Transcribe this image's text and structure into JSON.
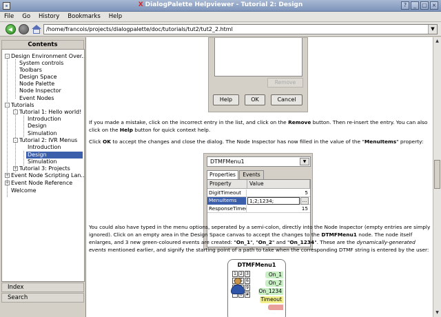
{
  "window": {
    "title": "DialogPalette Helpviewer - Tutorial 2: Design",
    "controls": [
      "?",
      "_",
      "□",
      "×"
    ]
  },
  "menubar": {
    "items": [
      "File",
      "Go",
      "History",
      "Bookmarks",
      "Help"
    ]
  },
  "toolbar": {
    "url": "/home/francois/projects/dialogpalette/doc/tutorials/tut2/tut2_2.html"
  },
  "sidebar": {
    "header": "Contents",
    "tree": [
      {
        "label": "Design Environment Over...",
        "level": 0,
        "expander": "-"
      },
      {
        "label": "System controls",
        "level": 1
      },
      {
        "label": "Toolbars",
        "level": 1
      },
      {
        "label": "Design Space",
        "level": 1
      },
      {
        "label": "Node Palette",
        "level": 1
      },
      {
        "label": "Node Inspector",
        "level": 1
      },
      {
        "label": "Event Nodes",
        "level": 1
      },
      {
        "label": "Tutorials",
        "level": 0,
        "expander": "-"
      },
      {
        "label": "Tutorial 1: Hello world!",
        "level": 1,
        "expander": "-"
      },
      {
        "label": "Introduction",
        "level": 2
      },
      {
        "label": "Design",
        "level": 2
      },
      {
        "label": "Simulation",
        "level": 2
      },
      {
        "label": "Tutorial 2: IVR Menus",
        "level": 1,
        "expander": "-"
      },
      {
        "label": "Introduction",
        "level": 2
      },
      {
        "label": "Design",
        "level": 2,
        "selected": true
      },
      {
        "label": "Simulation",
        "level": 2
      },
      {
        "label": "Tutorial 3: Projects",
        "level": 1,
        "expander": "+"
      },
      {
        "label": "Event Node Scripting Lan...",
        "level": 0,
        "expander": "+"
      },
      {
        "label": "Event Node Reference",
        "level": 0,
        "expander": "+"
      },
      {
        "label": "Welcome",
        "level": 0
      }
    ],
    "tabs": [
      "Index",
      "Search"
    ]
  },
  "content": {
    "dialog": {
      "remove": "Remove",
      "help": "Help",
      "ok": "OK",
      "cancel": "Cancel"
    },
    "p1": {
      "a": "If you made a mistake, click on the incorrect entry in the list, and click on the ",
      "b": "Remove",
      "c": " button. Then re-insert the entry. You can also click on the ",
      "d": "Help",
      "e": " button for quick context help."
    },
    "p2": {
      "a": "Click ",
      "b": "OK",
      "c": " to accept the changes and close the dialog. The Node Inspector has now filled in the value of the \"",
      "d": "MenuItems",
      "e": "\" property:"
    },
    "inspector": {
      "combo": "DTMFMenu1",
      "tabs": [
        "Properties",
        "Events"
      ],
      "col_property": "Property",
      "col_value": "Value",
      "rows": [
        {
          "prop": "DigitTimeout",
          "value": "5"
        },
        {
          "prop": "MenuItems",
          "value": "1;2;1234;"
        },
        {
          "prop": "ResponseTimeout",
          "value": "15"
        }
      ],
      "edit_button": "..."
    },
    "p3": {
      "a": "You could also have typed in the menu options, seperated by a semi-colon, directly into the Node Inspector (empty entries are simply ignored). Click on an empty area in the Design Space canvas to accept the changes to the ",
      "b": "DTMFMenu1",
      "c": " node. The node itself enlarges, and 3 new green-coloured events are created: \"",
      "d": "On_1",
      "e": "\", \"",
      "f": "On_2",
      "g": "\" and \"",
      "h": "On_1234",
      "i": "\". These are the ",
      "j": "dynamically-generated events",
      "k": " mentioned earlier, and signify the starting point of a path to take when the corresponding DTMF string is entered by the user:"
    },
    "dtmf_node": {
      "title": "DTMFMenu1",
      "keys": [
        "1",
        "2",
        "3",
        "4",
        "5",
        "6",
        "7",
        "8",
        "9",
        "*",
        "0",
        "#"
      ],
      "events": [
        "On_1",
        "On_2",
        "On_1234",
        "Timeout"
      ]
    }
  },
  "colors": {
    "titlebar": "#8fa3c7",
    "selection": "#3c5fac",
    "green_event": "#c9efc5",
    "timeout_event": "#f2f08a"
  }
}
